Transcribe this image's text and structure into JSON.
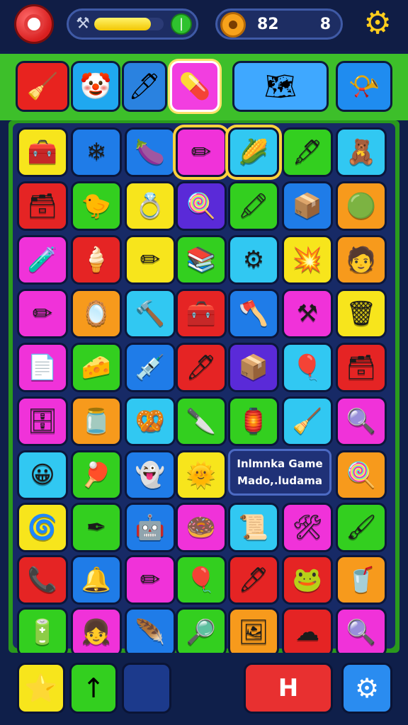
{
  "header": {
    "progress": 0.82,
    "stat_a": "82",
    "stat_b": "8"
  },
  "categories": [
    {
      "icon": "brush-icon",
      "glyph": "🧹",
      "color": "#e8231f"
    },
    {
      "icon": "clown-face-icon",
      "glyph": "🤡",
      "color": "#1fa8f0"
    },
    {
      "icon": "marker-icon",
      "glyph": "🖊",
      "color": "#2a82e0"
    },
    {
      "icon": "capsule-icon",
      "glyph": "💊",
      "color": "#f23ee0"
    },
    {
      "icon": "map-pencil-icon",
      "glyph": "🗺",
      "color": "#3fa8ff"
    },
    {
      "icon": "horn-icon",
      "glyph": "📯",
      "color": "#1f8cf0"
    }
  ],
  "tile_colors": {
    "yellow": "#f7e51c",
    "blue": "#1f7ce8",
    "cyan": "#31c8f2",
    "magenta": "#f032d9",
    "green": "#33cf1f",
    "red": "#e52424",
    "orange": "#f79a1c",
    "purple": "#5a2ad8"
  },
  "grid": [
    [
      {
        "c": "yellow",
        "icon": "box-icon",
        "glyph": "🧰"
      },
      {
        "c": "blue",
        "icon": "crystal-icon",
        "glyph": "❄"
      },
      {
        "c": "blue",
        "icon": "eggplant-icon",
        "glyph": "🍆"
      },
      {
        "c": "magenta",
        "icon": "crossed-pencils-icon",
        "glyph": "✏",
        "hl": true
      },
      {
        "c": "cyan",
        "icon": "corn-icon",
        "glyph": "🌽",
        "hl": true
      },
      {
        "c": "green",
        "icon": "pen-icon",
        "glyph": "🖋"
      },
      {
        "c": "cyan",
        "icon": "bear-icon",
        "glyph": "🧸"
      }
    ],
    [
      {
        "c": "red",
        "icon": "chest-icon",
        "glyph": "🗃"
      },
      {
        "c": "green",
        "icon": "duck-icon",
        "glyph": "🐤"
      },
      {
        "c": "yellow",
        "icon": "ring-icon",
        "glyph": "💍"
      },
      {
        "c": "purple",
        "icon": "lollipop-icon",
        "glyph": "🍭"
      },
      {
        "c": "green",
        "icon": "crayon-icon",
        "glyph": "🖍"
      },
      {
        "c": "blue",
        "icon": "cube-icon",
        "glyph": "📦"
      },
      {
        "c": "orange",
        "icon": "green-ring-icon",
        "glyph": "🟢"
      }
    ],
    [
      {
        "c": "magenta",
        "icon": "tube-icon",
        "glyph": "🧪"
      },
      {
        "c": "red",
        "icon": "ice-cream-icon",
        "glyph": "🍦"
      },
      {
        "c": "yellow",
        "icon": "pencil-icon",
        "glyph": "✏"
      },
      {
        "c": "green",
        "icon": "book-stack-icon",
        "glyph": "📚"
      },
      {
        "c": "cyan",
        "icon": "gear-icon",
        "glyph": "⚙"
      },
      {
        "c": "yellow",
        "icon": "splash-icon",
        "glyph": "💥"
      },
      {
        "c": "orange",
        "icon": "avatar-icon",
        "glyph": "🧑"
      }
    ],
    [
      {
        "c": "magenta",
        "icon": "pencil-icon",
        "glyph": "✏"
      },
      {
        "c": "orange",
        "icon": "mirror-icon",
        "glyph": "🪞"
      },
      {
        "c": "cyan",
        "icon": "hammer-icon",
        "glyph": "🔨"
      },
      {
        "c": "red",
        "icon": "treasure-icon",
        "glyph": "🧰"
      },
      {
        "c": "blue",
        "icon": "shovel-icon",
        "glyph": "🪓"
      },
      {
        "c": "magenta",
        "icon": "crossed-tools-icon",
        "glyph": "⚒"
      },
      {
        "c": "yellow",
        "icon": "trash-can-icon",
        "glyph": "🗑"
      }
    ],
    [
      {
        "c": "magenta",
        "icon": "eraser-icon",
        "glyph": "📄"
      },
      {
        "c": "green",
        "icon": "cheese-icon",
        "glyph": "🧀"
      },
      {
        "c": "blue",
        "icon": "syringe-icon",
        "glyph": "💉"
      },
      {
        "c": "red",
        "icon": "green-pen-icon",
        "glyph": "🖊"
      },
      {
        "c": "purple",
        "icon": "purple-box-icon",
        "glyph": "📦"
      },
      {
        "c": "cyan",
        "icon": "balloon-icon",
        "glyph": "🎈"
      },
      {
        "c": "red",
        "icon": "green-chest-icon",
        "glyph": "🗃"
      }
    ],
    [
      {
        "c": "magenta",
        "icon": "green-box-icon",
        "glyph": "🗄"
      },
      {
        "c": "orange",
        "icon": "jar-icon",
        "glyph": "🫙"
      },
      {
        "c": "cyan",
        "icon": "pretzel-icon",
        "glyph": "🥨"
      },
      {
        "c": "green",
        "icon": "spatula-icon",
        "glyph": "🔪"
      },
      {
        "c": "green",
        "icon": "lantern-icon",
        "glyph": "🏮"
      },
      {
        "c": "cyan",
        "icon": "broom-icon",
        "glyph": "🧹"
      },
      {
        "c": "magenta",
        "icon": "magnifier-icon",
        "glyph": "🔍"
      }
    ],
    [
      {
        "c": "cyan",
        "icon": "face-icon",
        "glyph": "😀"
      },
      {
        "c": "green",
        "icon": "racket-icon",
        "glyph": "🏓"
      },
      {
        "c": "blue",
        "icon": "ghost-icon",
        "glyph": "👻"
      },
      {
        "c": "yellow",
        "icon": "sun-icon",
        "glyph": "🌞"
      },
      {
        "c": "none",
        "icon": "",
        "glyph": ""
      },
      {
        "c": "none",
        "icon": "",
        "glyph": ""
      },
      {
        "c": "orange",
        "icon": "lollipop-icon",
        "glyph": "🍭"
      }
    ],
    [
      {
        "c": "yellow",
        "icon": "spiral-icon",
        "glyph": "🌀"
      },
      {
        "c": "green",
        "icon": "fountain-pen-icon",
        "glyph": "✒"
      },
      {
        "c": "blue",
        "icon": "robot-icon",
        "glyph": "🤖"
      },
      {
        "c": "magenta",
        "icon": "donut-icon",
        "glyph": "🍩"
      },
      {
        "c": "cyan",
        "icon": "scroll-icon",
        "glyph": "📜"
      },
      {
        "c": "magenta",
        "icon": "tools-icon",
        "glyph": "🛠"
      },
      {
        "c": "green",
        "icon": "brush-pen-icon",
        "glyph": "🖌"
      }
    ],
    [
      {
        "c": "red",
        "icon": "phone-icon",
        "glyph": "📞"
      },
      {
        "c": "blue",
        "icon": "bell-icon",
        "glyph": "🔔"
      },
      {
        "c": "magenta",
        "icon": "pencil-icon",
        "glyph": "✏"
      },
      {
        "c": "green",
        "icon": "balloon-icon",
        "glyph": "🎈"
      },
      {
        "c": "red",
        "icon": "marker-icon",
        "glyph": "🖊"
      },
      {
        "c": "red",
        "icon": "frog-icon",
        "glyph": "🐸"
      },
      {
        "c": "orange",
        "icon": "cup-icon",
        "glyph": "🥤"
      }
    ],
    [
      {
        "c": "green",
        "icon": "battery-icon",
        "glyph": "🔋"
      },
      {
        "c": "magenta",
        "icon": "girl-icon",
        "glyph": "👧"
      },
      {
        "c": "blue",
        "icon": "feather-icon",
        "glyph": "🪶"
      },
      {
        "c": "green",
        "icon": "magnifier-icon",
        "glyph": "🔎"
      },
      {
        "c": "orange",
        "icon": "frame-icon",
        "glyph": "🖼"
      },
      {
        "c": "red",
        "icon": "cloud-icon",
        "glyph": "☁"
      },
      {
        "c": "magenta",
        "icon": "search-icon",
        "glyph": "🔍"
      }
    ]
  ],
  "info_panel": {
    "line1": "Inlmnka Game",
    "line2": "Mado,.ludama"
  },
  "bottom": {
    "btn1_icon": "star-icon",
    "btn1_glyph": "⭐",
    "btn1_color": "#f7e51c",
    "btn2_icon": "arrow-up-icon",
    "btn2_glyph": "↑",
    "btn2_color": "#33cf1f",
    "btn3_color": "#1c3a8c",
    "btn4_label": "H",
    "btn4_color": "#e83030",
    "btn5_icon": "gear-icon",
    "btn5_glyph": "⚙",
    "btn5_color": "#2a8cf0"
  }
}
